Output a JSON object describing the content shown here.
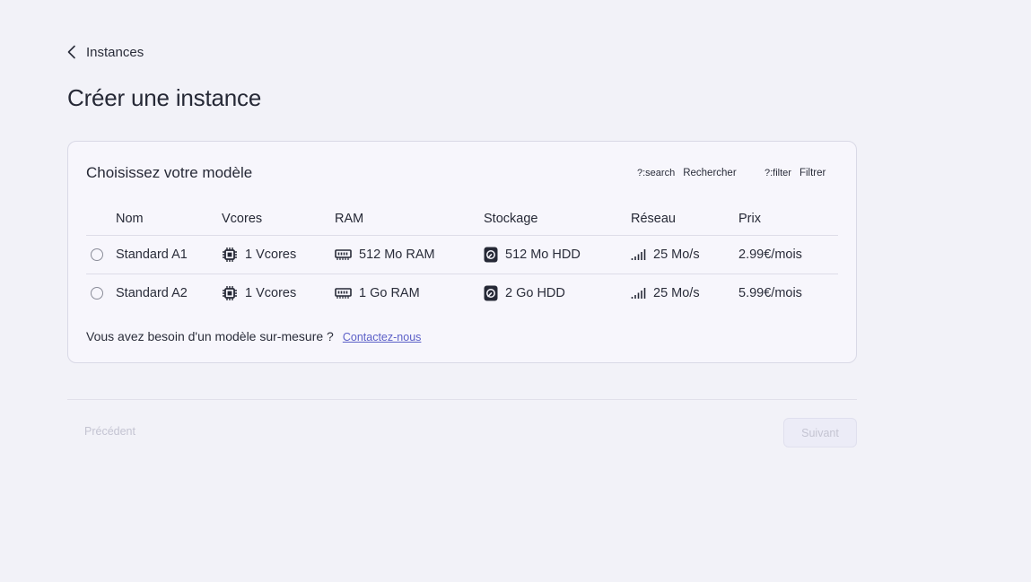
{
  "breadcrumb": {
    "back_label": "Instances"
  },
  "page": {
    "title": "Créer une instance"
  },
  "card": {
    "title": "Choisissez votre modèle",
    "search": {
      "glyph": "?:search",
      "label": "Rechercher"
    },
    "filter": {
      "glyph": "?:filter",
      "label": "Filtrer"
    },
    "columns": [
      "Nom",
      "Vcores",
      "RAM",
      "Stockage",
      "Réseau",
      "Prix"
    ],
    "rows": [
      {
        "name": "Standard A1",
        "vcores": "1 Vcores",
        "ram": "512 Mo RAM",
        "storage": "512 Mo HDD",
        "network": "25 Mo/s",
        "price": "2.99€/mois",
        "selected": false
      },
      {
        "name": "Standard A2",
        "vcores": "1 Vcores",
        "ram": "1 Go RAM",
        "storage": "2 Go HDD",
        "network": "25 Mo/s",
        "price": "5.99€/mois",
        "selected": false
      }
    ],
    "icons": {
      "vcores": "cpu-icon",
      "ram": "memory-icon",
      "storage": "hard-drive-icon",
      "network": "signal-icon"
    },
    "custom_text": "Vous avez besoin d'un modèle sur-mesure ?",
    "contact_label": "Contactez-nous"
  },
  "footer": {
    "prev_label": "Précédent",
    "next_label": "Suivant"
  },
  "colors": {
    "background": "#f2f2f8",
    "card": "#f7f6fc",
    "accent": "#5b5fc7",
    "disabled_text": "#c4c4d2"
  }
}
